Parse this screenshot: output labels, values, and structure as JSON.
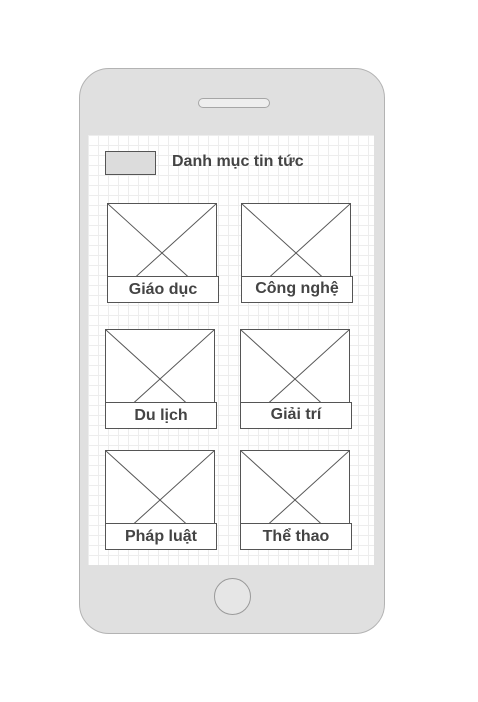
{
  "header": {
    "title": "Danh mục tin tức"
  },
  "categories": [
    {
      "label": "Giáo dục"
    },
    {
      "label": "Công nghệ"
    },
    {
      "label": "Du lịch"
    },
    {
      "label": "Giải trí"
    },
    {
      "label": "Pháp luật"
    },
    {
      "label": "Thể thao"
    }
  ],
  "colors": {
    "phone_body": "#e0e0e0",
    "border": "#555555",
    "text": "#444444"
  },
  "icons": {
    "image_placeholder": "image-placeholder-icon"
  }
}
